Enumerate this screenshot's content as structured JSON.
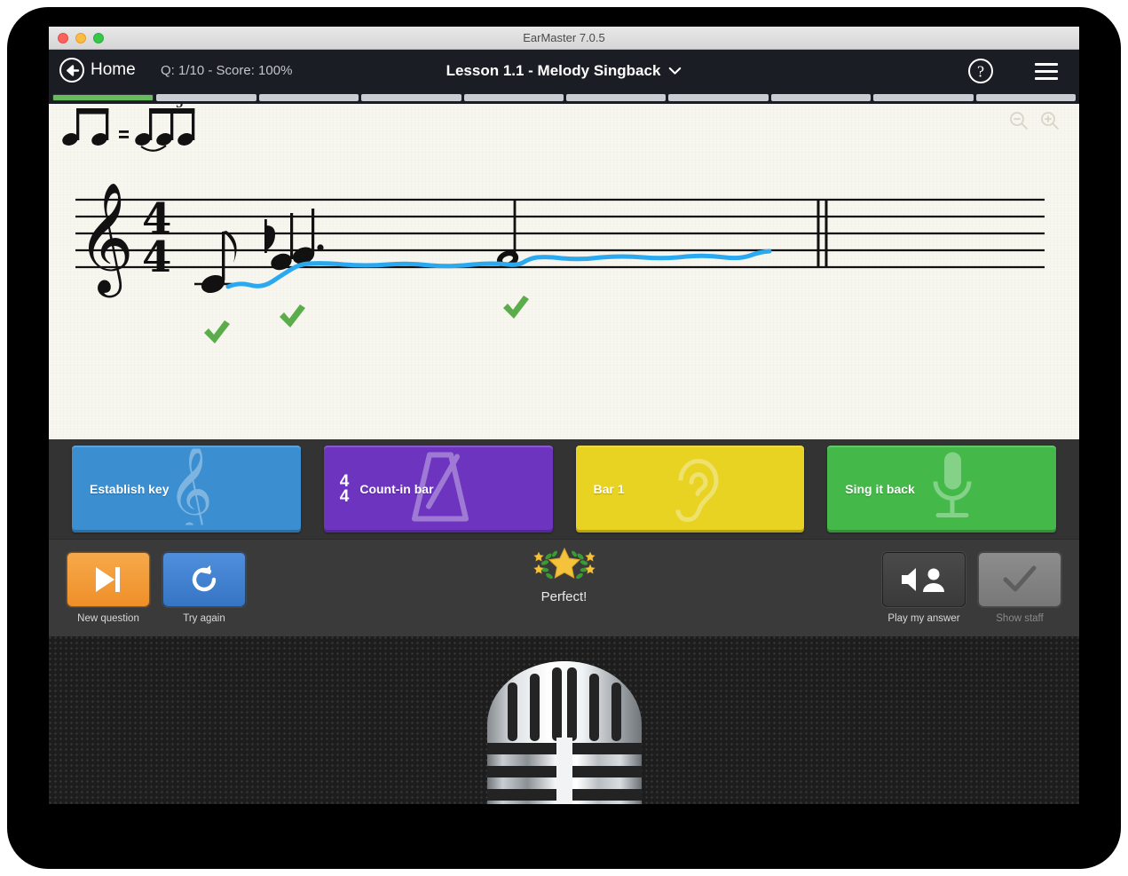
{
  "window": {
    "title": "EarMaster 7.0.5",
    "traffic_lights": [
      "close",
      "minimize",
      "zoom"
    ]
  },
  "header": {
    "home_label": "Home",
    "back_icon": "back-arrow-icon",
    "progress_text": "Q: 1/10 - Score: 100%",
    "lesson_title": "Lesson 1.1 - Melody Singback",
    "lesson_dropdown_icon": "chevron-down-icon",
    "help_icon": "help-question-icon",
    "menu_icon": "hamburger-menu-icon"
  },
  "progress": {
    "total_segments": 10,
    "completed_segments": 1,
    "done_color": "#68bb5d",
    "pending_color": "#c9ccd1"
  },
  "score": {
    "swing_notation": "eighth-notes-equals-swung-triplet",
    "clef": "treble-clef",
    "time_signature": {
      "numerator": "4",
      "denominator": "4"
    },
    "zoom_out_icon": "zoom-out-icon",
    "zoom_in_icon": "zoom-in-icon",
    "pitch_trace_color": "#2aa9f0",
    "checkmark_color": "#5aad4a",
    "correct_marks": 3,
    "notes": [
      {
        "name": "quarter-note-ledger",
        "correct": true
      },
      {
        "name": "eighth-note-flat",
        "correct": true
      },
      {
        "name": "dotted-quarter-note",
        "correct": true
      },
      {
        "name": "half-note",
        "correct": true
      }
    ],
    "barlines": 2
  },
  "stages": [
    {
      "label": "Establish key",
      "icon": "treble-clef-icon",
      "color": "#3b8ed0",
      "time_signature": null
    },
    {
      "label": "Count-in bar",
      "icon": "metronome-icon",
      "color": "#6d35bf",
      "time_signature": {
        "numerator": "4",
        "denominator": "4"
      }
    },
    {
      "label": "Bar 1",
      "icon": "ear-icon",
      "color": "#e8d222",
      "time_signature": null
    },
    {
      "label": "Sing it back",
      "icon": "microphone-icon",
      "color": "#44b94a",
      "time_signature": null
    }
  ],
  "controls": {
    "left": [
      {
        "caption": "New question",
        "icon": "skip-next-icon",
        "style": "orange",
        "disabled": false
      },
      {
        "caption": "Try again",
        "icon": "reload-icon",
        "style": "blue",
        "disabled": false
      }
    ],
    "right": [
      {
        "caption": "Play my answer",
        "icon": "speaker-person-icon",
        "style": "dark",
        "disabled": false
      },
      {
        "caption": "Show staff",
        "icon": "checkmark-icon",
        "style": "grey",
        "disabled": true
      }
    ],
    "verdict": {
      "text": "Perfect!",
      "icon": "star-laurel-badge",
      "star_color": "#f5c33b",
      "laurel_color": "#3a9b35"
    }
  },
  "mic_panel": {
    "icon": "vintage-microphone",
    "ring_color": "#3a9b35"
  }
}
